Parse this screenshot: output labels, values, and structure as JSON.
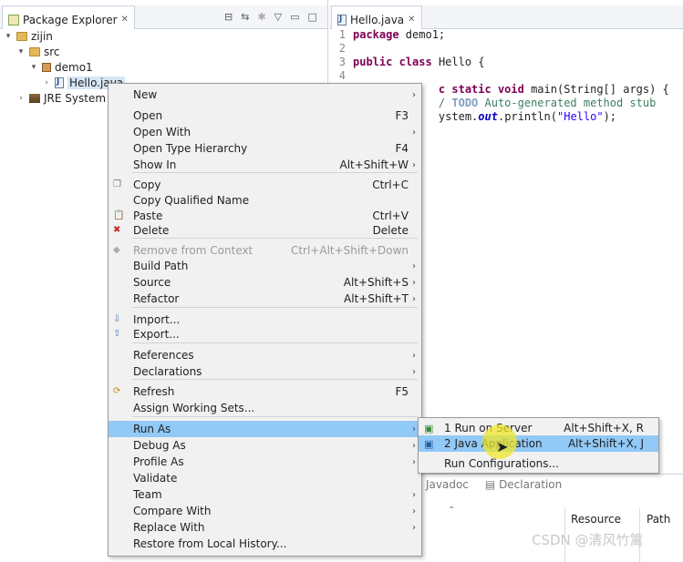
{
  "package_explorer": {
    "tab_title": "Package Explorer",
    "tree": [
      {
        "label": "zijin",
        "depth": 0,
        "expanded": true,
        "kind": "project"
      },
      {
        "label": "src",
        "depth": 1,
        "expanded": true,
        "kind": "folder"
      },
      {
        "label": "demo1",
        "depth": 2,
        "expanded": true,
        "kind": "package"
      },
      {
        "label": "Hello.java",
        "depth": 3,
        "expanded": false,
        "kind": "file"
      },
      {
        "label": "JRE System L",
        "depth": 1,
        "expanded": false,
        "kind": "library"
      }
    ]
  },
  "editor": {
    "tab_title": "Hello.java",
    "lines": [
      {
        "num": "1",
        "code": "package demo1;"
      },
      {
        "num": "2",
        "code": ""
      },
      {
        "num": "3",
        "code": "public class Hello {"
      },
      {
        "num": "4",
        "code": ""
      },
      {
        "num": "5",
        "code": "c static void main(String[] args) {"
      },
      {
        "num": "6",
        "code": "/ TODO Auto-generated method stub"
      },
      {
        "num": "7",
        "code": "ystem.out.println(\"Hello\");"
      }
    ]
  },
  "context_menu": {
    "items": [
      {
        "label": "New",
        "shortcut": "",
        "submenu": true,
        "icon": "",
        "disabled": false
      },
      {
        "label": "Open",
        "shortcut": "F3",
        "submenu": false,
        "icon": "",
        "disabled": false
      },
      {
        "label": "Open With",
        "shortcut": "",
        "submenu": true,
        "icon": "",
        "disabled": false
      },
      {
        "label": "Open Type Hierarchy",
        "shortcut": "F4",
        "submenu": false,
        "icon": "",
        "disabled": false
      },
      {
        "label": "Show In",
        "shortcut": "Alt+Shift+W",
        "submenu": true,
        "icon": "",
        "disabled": false
      },
      {
        "label": "Copy",
        "shortcut": "Ctrl+C",
        "submenu": false,
        "icon": "copy-icon",
        "disabled": false
      },
      {
        "label": "Copy Qualified Name",
        "shortcut": "",
        "submenu": false,
        "icon": "",
        "disabled": false
      },
      {
        "label": "Paste",
        "shortcut": "Ctrl+V",
        "submenu": false,
        "icon": "paste-icon",
        "disabled": false
      },
      {
        "label": "Delete",
        "shortcut": "Delete",
        "submenu": false,
        "icon": "delete-icon",
        "disabled": false
      },
      {
        "label": "Remove from Context",
        "shortcut": "Ctrl+Alt+Shift+Down",
        "submenu": false,
        "icon": "remove-context-icon",
        "disabled": true
      },
      {
        "label": "Build Path",
        "shortcut": "",
        "submenu": true,
        "icon": "",
        "disabled": false
      },
      {
        "label": "Source",
        "shortcut": "Alt+Shift+S",
        "submenu": true,
        "icon": "",
        "disabled": false
      },
      {
        "label": "Refactor",
        "shortcut": "Alt+Shift+T",
        "submenu": true,
        "icon": "",
        "disabled": false
      },
      {
        "label": "Import...",
        "shortcut": "",
        "submenu": false,
        "icon": "import-icon",
        "disabled": false
      },
      {
        "label": "Export...",
        "shortcut": "",
        "submenu": false,
        "icon": "export-icon",
        "disabled": false
      },
      {
        "label": "References",
        "shortcut": "",
        "submenu": true,
        "icon": "",
        "disabled": false
      },
      {
        "label": "Declarations",
        "shortcut": "",
        "submenu": true,
        "icon": "",
        "disabled": false
      },
      {
        "label": "Refresh",
        "shortcut": "F5",
        "submenu": false,
        "icon": "refresh-icon",
        "disabled": false
      },
      {
        "label": "Assign Working Sets...",
        "shortcut": "",
        "submenu": false,
        "icon": "",
        "disabled": false
      },
      {
        "label": "Run As",
        "shortcut": "",
        "submenu": true,
        "icon": "",
        "disabled": false,
        "selected": true
      },
      {
        "label": "Debug As",
        "shortcut": "",
        "submenu": true,
        "icon": "",
        "disabled": false
      },
      {
        "label": "Profile As",
        "shortcut": "",
        "submenu": true,
        "icon": "",
        "disabled": false
      },
      {
        "label": "Validate",
        "shortcut": "",
        "submenu": false,
        "icon": "",
        "disabled": false
      },
      {
        "label": "Team",
        "shortcut": "",
        "submenu": true,
        "icon": "",
        "disabled": false
      },
      {
        "label": "Compare With",
        "shortcut": "",
        "submenu": true,
        "icon": "",
        "disabled": false
      },
      {
        "label": "Replace With",
        "shortcut": "",
        "submenu": true,
        "icon": "",
        "disabled": false
      },
      {
        "label": "Restore from Local History...",
        "shortcut": "",
        "submenu": false,
        "icon": "",
        "disabled": false
      }
    ]
  },
  "run_as_submenu": {
    "items": [
      {
        "label": "1 Run on Server",
        "shortcut": "Alt+Shift+X, R",
        "icon": "server-icon"
      },
      {
        "label": "2 Java Application",
        "shortcut": "Alt+Shift+X, J",
        "icon": "java-app-icon",
        "selected": true
      },
      {
        "label": "Run Configurations...",
        "shortcut": "",
        "icon": ""
      }
    ]
  },
  "bottom_panel": {
    "tabs": [
      "Javadoc",
      "Declaration"
    ],
    "columns": [
      "Resource",
      "Path"
    ]
  },
  "watermark": "CSDN @清风竹篱"
}
